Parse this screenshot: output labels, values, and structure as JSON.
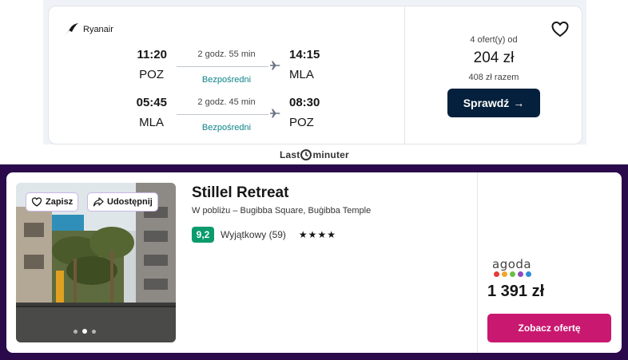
{
  "flight": {
    "airline": "Ryanair",
    "outbound": {
      "dep_time": "11:20",
      "dep_code": "POZ",
      "duration": "2 godz. 55 min",
      "stops": "Bezpośredni",
      "arr_time": "14:15",
      "arr_code": "MLA"
    },
    "inbound": {
      "dep_time": "05:45",
      "dep_code": "MLA",
      "duration": "2 godz. 45 min",
      "stops": "Bezpośredni",
      "arr_time": "08:30",
      "arr_code": "POZ"
    },
    "offers_count": "4 ofert(y) od",
    "price": "204 zł",
    "total": "408 zł razem",
    "check_label": "Sprawdź",
    "favorite_icon": "heart-icon",
    "accent_color": "#05203c",
    "direct_color": "#0c838a"
  },
  "brand": {
    "prefix": "Last",
    "suffix": "minuter"
  },
  "hotel": {
    "save_label": "Zapisz",
    "share_label": "Udostępnij",
    "name": "Stillel Retreat",
    "location": "W pobliżu – Bugibba Square, Buġibba Temple",
    "score": "9,2",
    "rating_label": "Wyjątkowy (59)",
    "stars": "★★★★",
    "provider": "agoda",
    "price": "1 391 zł",
    "offer_label": "Zobacz ofertę",
    "photo_count": 3,
    "photo_active_index": 1,
    "button_color": "#c9186f",
    "score_color": "#0b9b6c",
    "background_color": "#2a0a4a"
  }
}
